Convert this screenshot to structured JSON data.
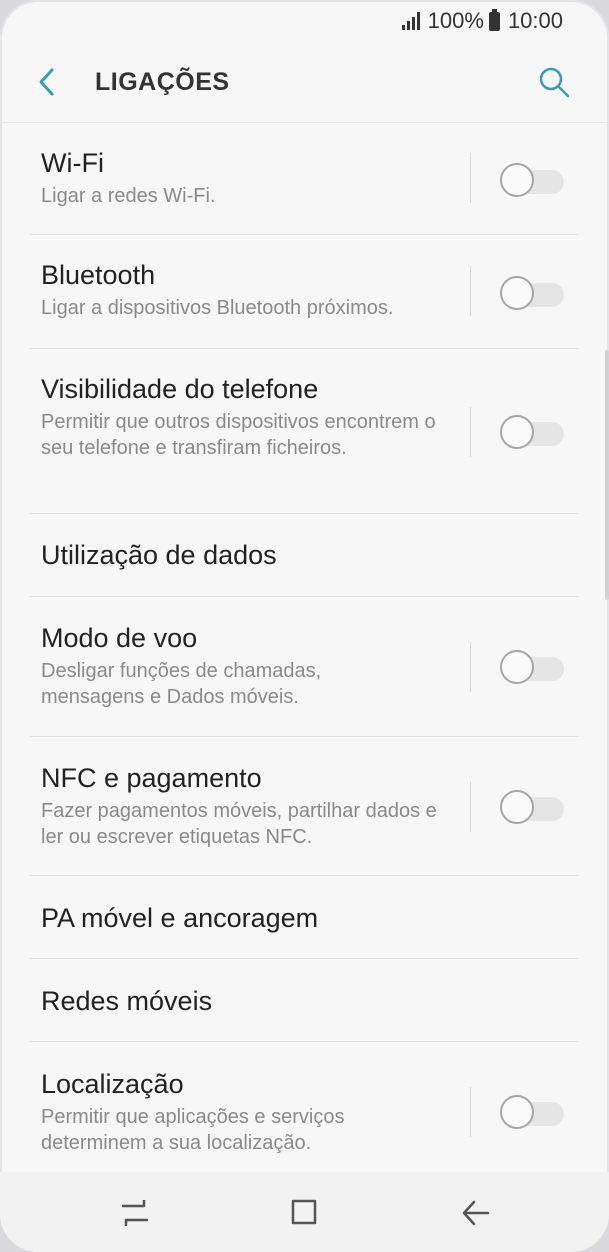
{
  "status": {
    "battery": "100%",
    "time": "10:00"
  },
  "header": {
    "title": "LIGAÇÕES"
  },
  "items": [
    {
      "title": "Wi-Fi",
      "subtitle": "Ligar a redes Wi-Fi.",
      "toggle": "off"
    },
    {
      "title": "Bluetooth",
      "subtitle": "Ligar a dispositivos Bluetooth próximos.",
      "toggle": "off"
    },
    {
      "title": "Visibilidade do telefone",
      "subtitle": "Permitir que outros dispositivos encontrem o seu telefone e transfiram ficheiros.",
      "toggle": "off"
    },
    {
      "title": "Utilização de dados"
    },
    {
      "title": "Modo de voo",
      "subtitle": "Desligar funções de chamadas, mensagens e Dados móveis.",
      "toggle": "off"
    },
    {
      "title": "NFC e pagamento",
      "subtitle": "Fazer pagamentos móveis, partilhar dados e ler ou escrever etiquetas NFC.",
      "toggle": "off"
    },
    {
      "title": "PA móvel e ancoragem"
    },
    {
      "title": "Redes móveis"
    },
    {
      "title": "Localização",
      "subtitle": "Permitir que aplicações e serviços determinem a sua localização.",
      "toggle": "off"
    }
  ],
  "colors": {
    "accent": "#3a9bb8",
    "text": "#222222",
    "secondary": "#8a8a8a"
  },
  "navbar": {
    "icons": [
      "recent-apps-icon",
      "home-icon",
      "back-icon"
    ]
  }
}
